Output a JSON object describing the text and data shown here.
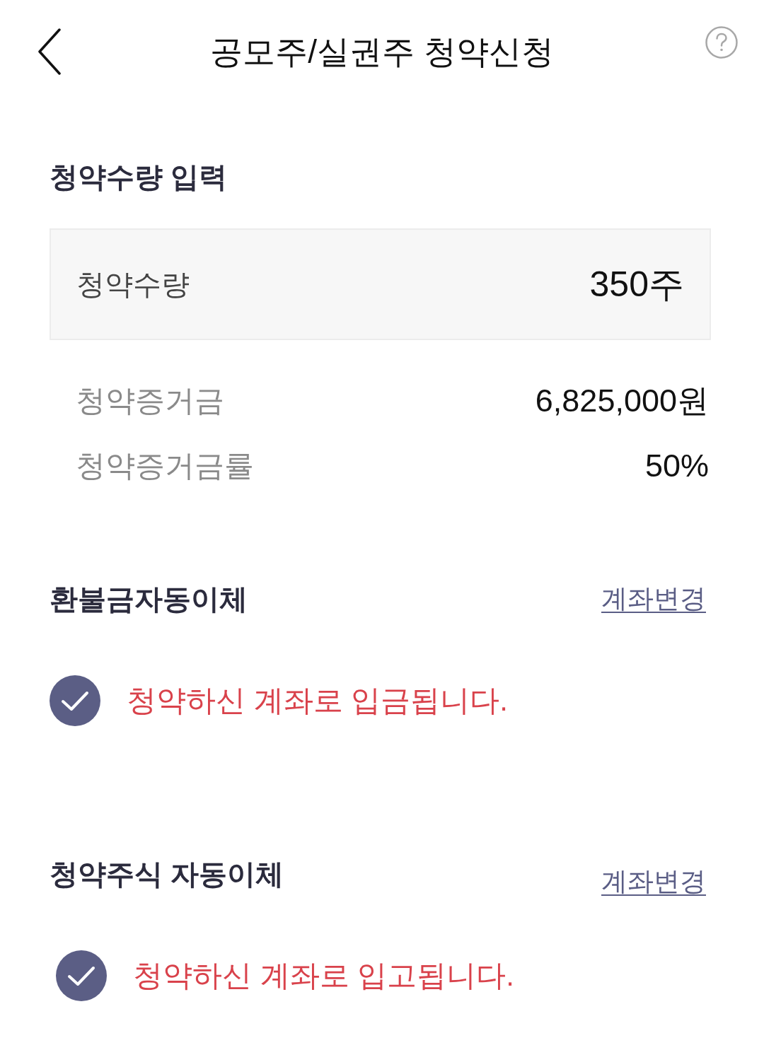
{
  "header": {
    "title": "공모주/실권주 청약신청"
  },
  "quantity_section": {
    "title": "청약수량 입력",
    "quantity": {
      "label": "청약수량",
      "value": "350주"
    },
    "details": [
      {
        "label": "청약증거금",
        "value": "6,825,000원"
      },
      {
        "label": "청약증거금률",
        "value": "50%"
      }
    ]
  },
  "transfers": [
    {
      "title": "환불금자동이체",
      "link": "계좌변경",
      "checked": true,
      "message": "청약하신 계좌로 입금됩니다."
    },
    {
      "title": "청약주식 자동이체",
      "link": "계좌변경",
      "checked": true,
      "message": "청약하신 계좌로 입고됩니다."
    }
  ]
}
